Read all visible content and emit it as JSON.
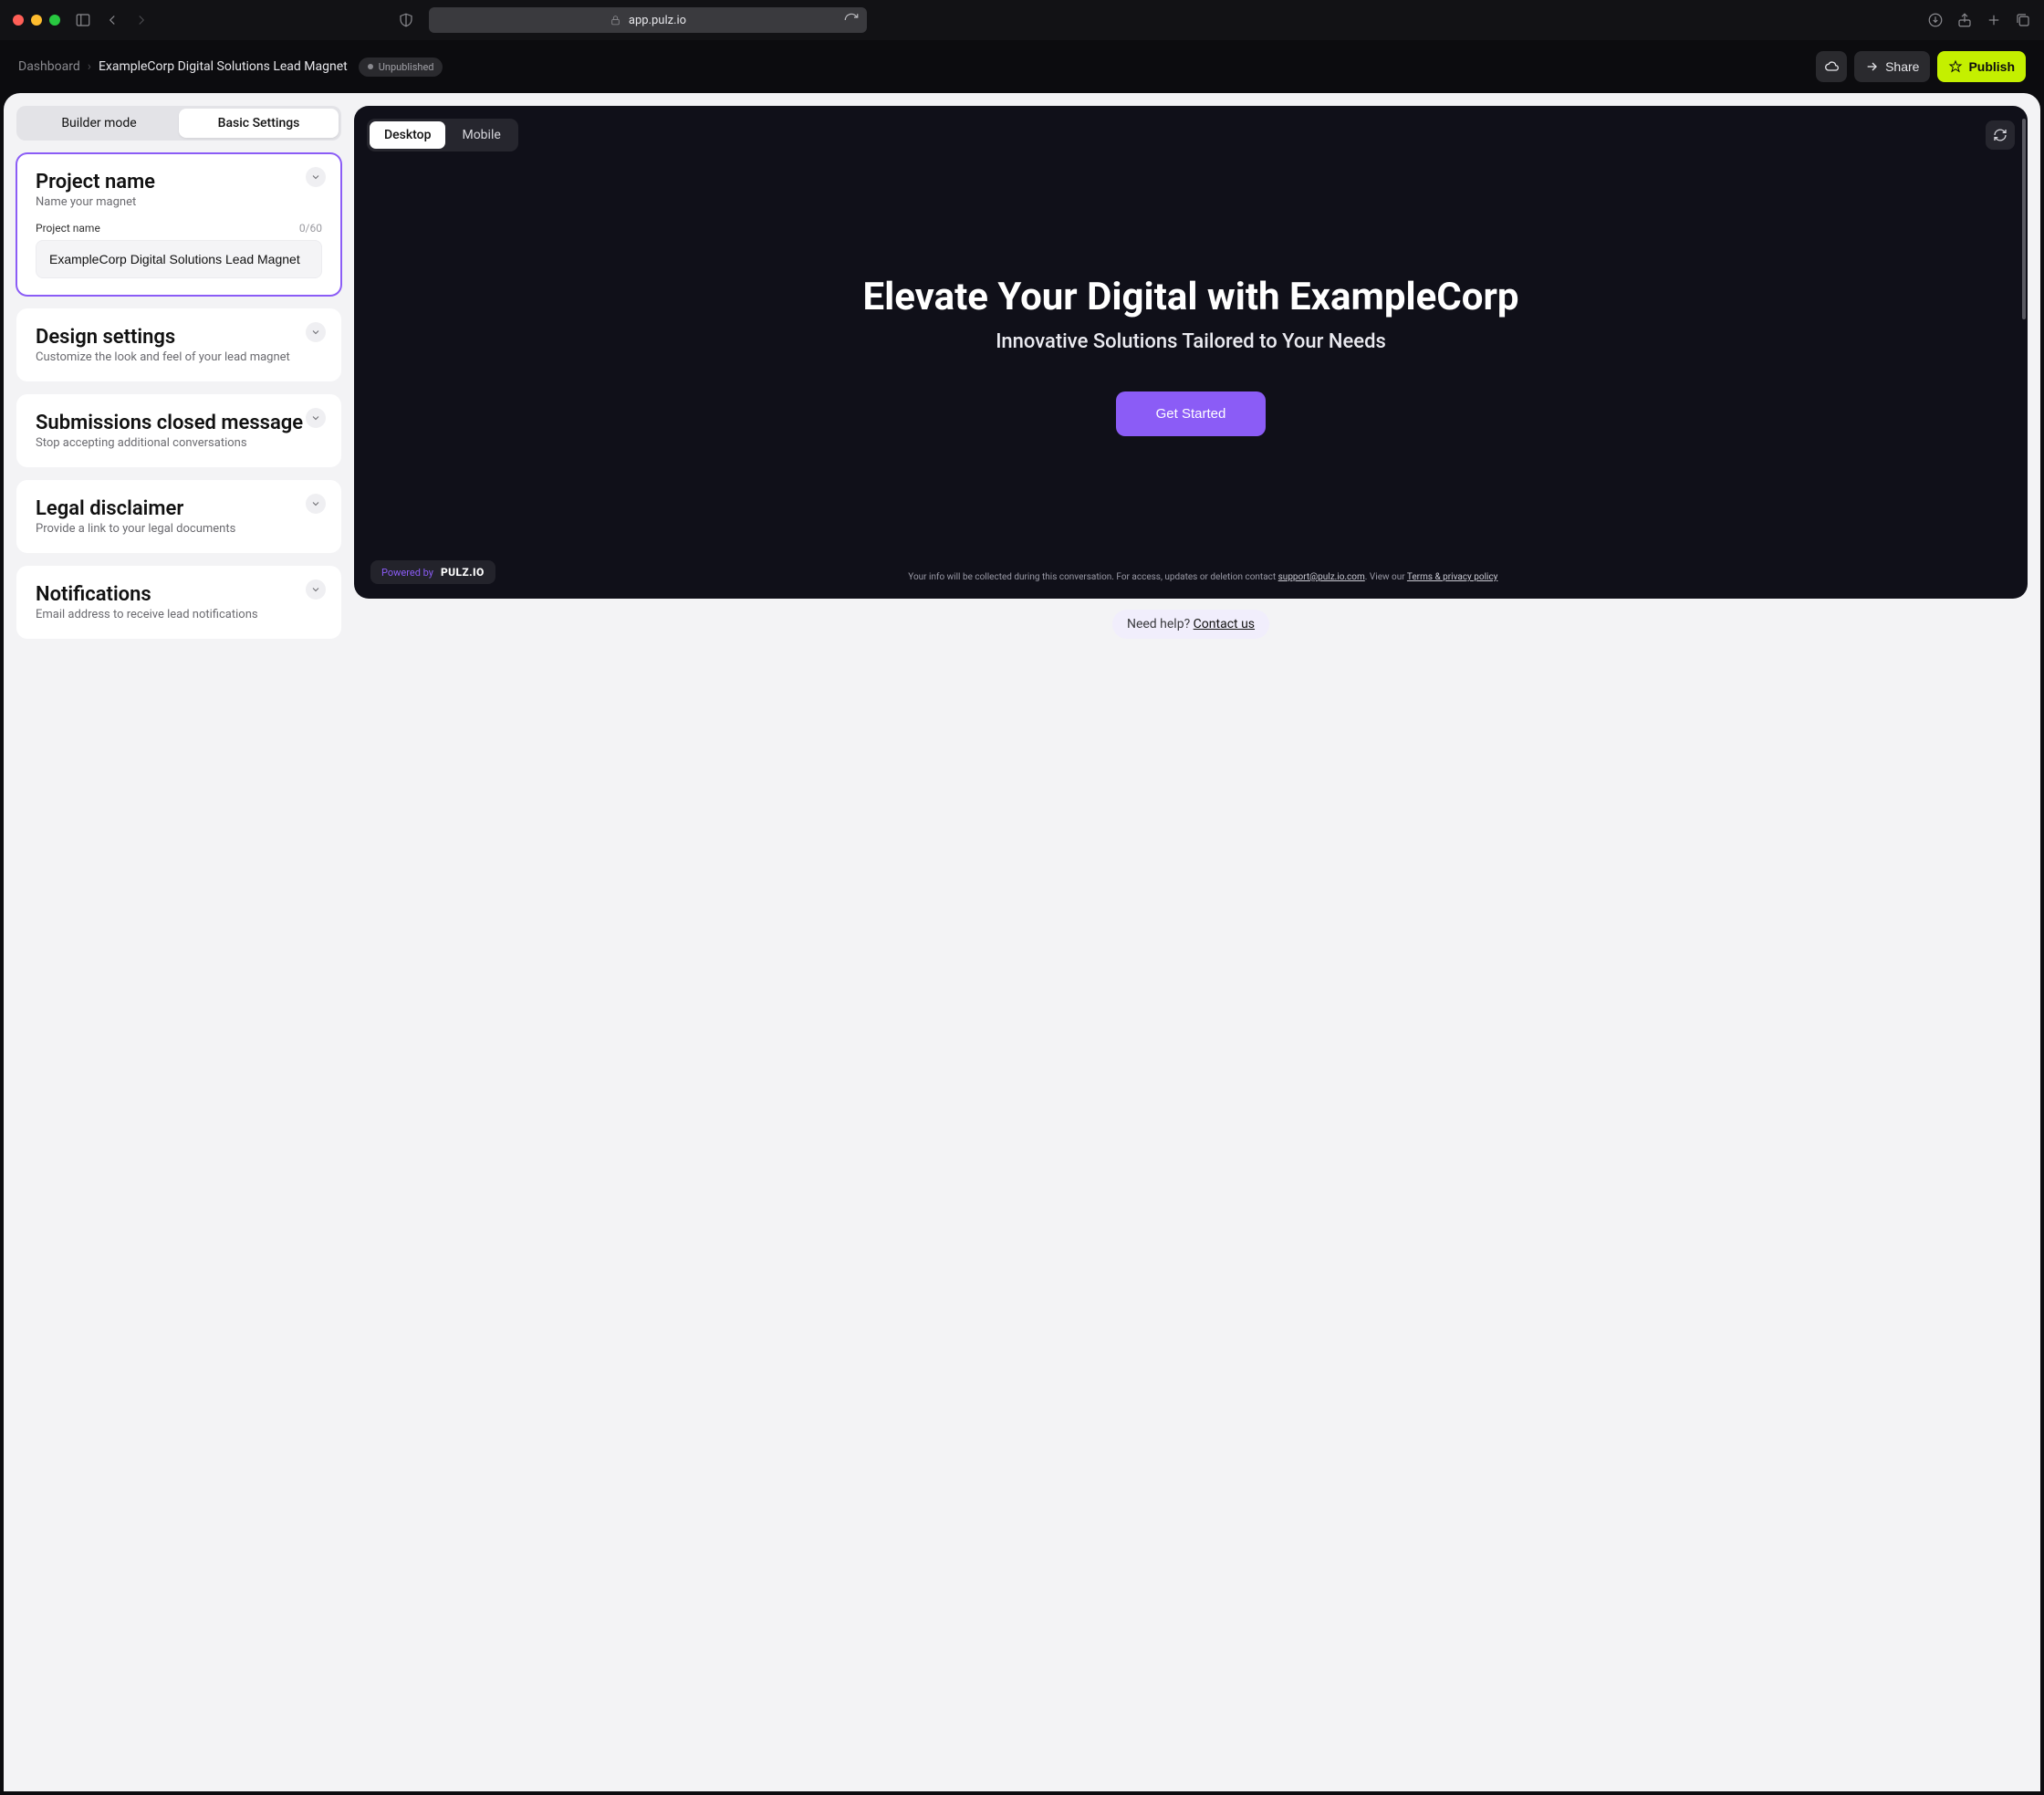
{
  "browser": {
    "url": "app.pulz.io"
  },
  "breadcrumbs": {
    "root": "Dashboard",
    "current": "ExampleCorp Digital Solutions Lead Magnet"
  },
  "status": {
    "label": "Unpublished"
  },
  "actions": {
    "share": "Share",
    "publish": "Publish"
  },
  "tabs": {
    "builder": "Builder mode",
    "basic": "Basic Settings"
  },
  "panels": {
    "project_name": {
      "title": "Project name",
      "subtitle": "Name your magnet",
      "field_label": "Project name",
      "counter": "0/60",
      "value": "ExampleCorp Digital Solutions Lead Magnet"
    },
    "design": {
      "title": "Design settings",
      "subtitle": "Customize the look and feel of your lead magnet"
    },
    "submissions": {
      "title": "Submissions closed message",
      "subtitle": "Stop accepting additional conversations"
    },
    "legal": {
      "title": "Legal disclaimer",
      "subtitle": "Provide a link to your legal documents"
    },
    "notifications": {
      "title": "Notifications",
      "subtitle": "Email address to receive lead notifications"
    }
  },
  "preview": {
    "devices": {
      "desktop": "Desktop",
      "mobile": "Mobile"
    },
    "hero_title": "Elevate Your Digital with ExampleCorp",
    "hero_subtitle": "Innovative Solutions Tailored to Your Needs",
    "cta": "Get Started",
    "powered_label": "Powered by",
    "powered_logo": "PULZ.IO",
    "fine_line1": "Your info will be collected during this conversation. For access, updates or deletion contact ",
    "fine_email": "support@pulz.io.com",
    "fine_line2": ". View our ",
    "fine_terms": "Terms & privacy policy"
  },
  "help": {
    "prefix": "Need help? ",
    "link": "Contact us"
  }
}
